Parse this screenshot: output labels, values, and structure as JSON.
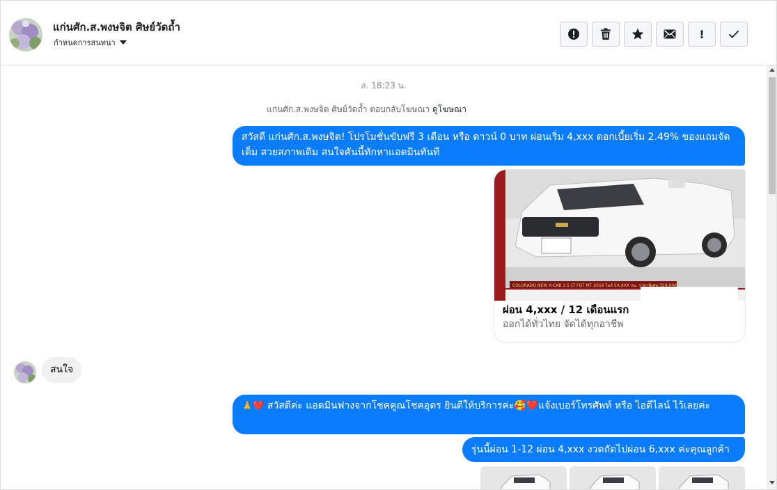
{
  "header": {
    "contact_name": "แก่นศัก.ส.พงษจิต ศิษย์วัดถ้ำ",
    "assign_label": "กำหนดการสนทนา",
    "actions": [
      {
        "icon": "exclamation-circle-icon",
        "label": "Mark as spam"
      },
      {
        "icon": "trash-icon",
        "label": "Delete"
      },
      {
        "icon": "star-icon",
        "label": "Follow up"
      },
      {
        "icon": "envelope-icon",
        "label": "Mark as unread"
      },
      {
        "icon": "exclamation-icon",
        "label": "Important"
      },
      {
        "icon": "check-icon",
        "label": "Done"
      }
    ]
  },
  "conversation": {
    "timestamp": "ส. 18:23 น.",
    "ad_reply_text": "แก่นศัก.ส.พงษจิต ศิษย์วัดถ้ำ ตอบกลับโฆษณา",
    "ad_reply_link": "ดูโฆษณา",
    "msg1": "สวัสดี แก่นศัก.ส.พงษจิต! โปรโมชั่นขับฟรี 3 เดือน หรือ ดาวน์ 0 บาท ผ่อนเริ่ม 4,xxx ดอกเบี้ยเริ่ม 2.49% ของแถมจัดเต็ม สวยสภาพเดิม สนใจคันนี้ทักหาแอดมินทันที",
    "card": {
      "title": "ผ่อน 4,xxx / 12 เดือนแรก",
      "subtitle": "ออกได้ทั่วไทย จัดได้ทุกอาชีพ",
      "image_caption": "COLORADO NEW X-CAB 2.5 LT FGT MT 2019 ไมล์ 5X,XXX กม. ราคาพิเศษ 359,000"
    },
    "msg_in": "สนใจ",
    "msg3_prefix": "🙏❤️",
    "msg3": "สวัสดีค่ะ แอดมินฟางจากโชคคูณโชคอุดร ยินดีให้บริการค่ะ🥰❤️แจ้งเบอร์โทรศัพท์ หรือ ไอดีไลน์  ไว้เลยค่ะ",
    "msg4": "รุ่นนี้ผ่อน 1-12 ผ่อน 4,xxx งวดถัดไปผ่อน 6,xxx ค่ะคุณลูกค้า"
  },
  "colors": {
    "outgoing_bubble": "#0a7cff",
    "incoming_bubble": "#f0f0f0",
    "toolbar_button": "#f5f6f7"
  }
}
